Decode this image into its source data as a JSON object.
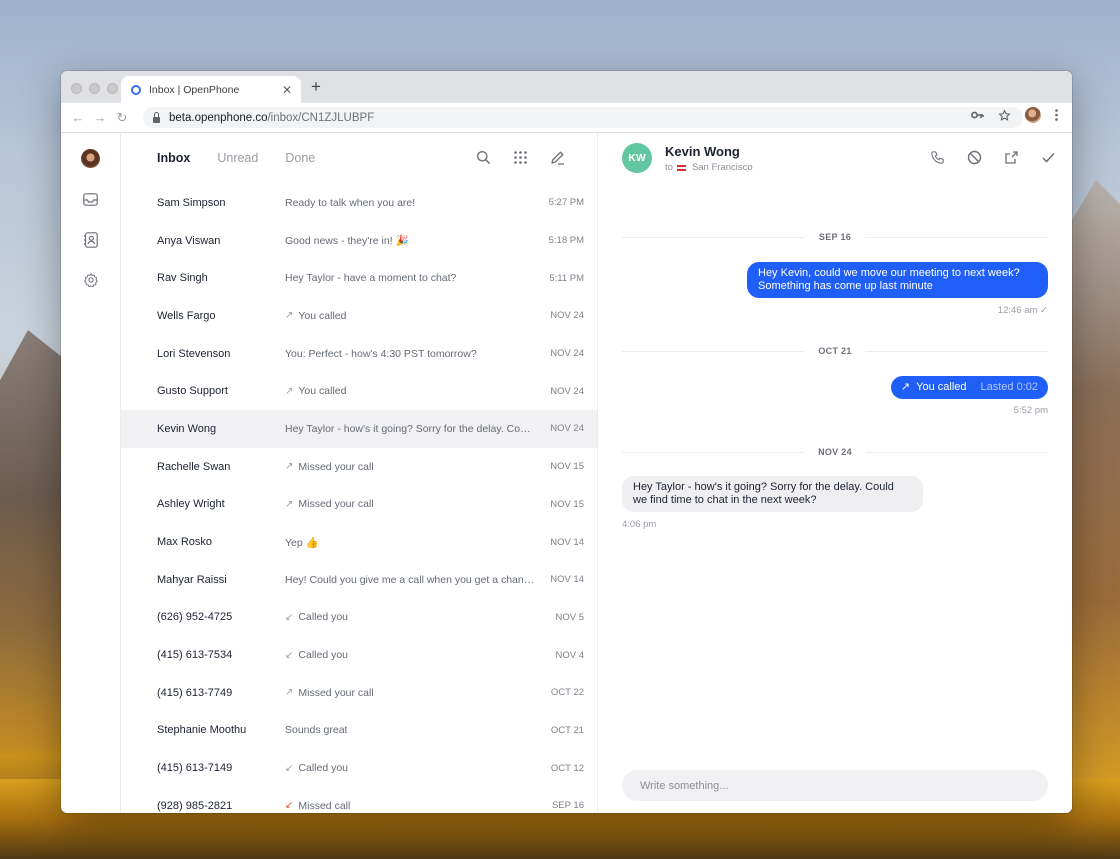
{
  "browser": {
    "tab_title": "Inbox | OpenPhone",
    "tab_close": "✕",
    "new_tab": "+",
    "url_host": "beta.openphone.co",
    "url_path": "/inbox/CN1ZJLUBPF",
    "back": "←",
    "forward": "→",
    "reload": "↻"
  },
  "list": {
    "tabs": [
      "Inbox",
      "Unread",
      "Done"
    ],
    "rows": [
      {
        "name": "Sam Simpson",
        "message": "Ready to talk when you are!",
        "arrow": "",
        "time": "5:27 PM"
      },
      {
        "name": "Anya Viswan",
        "message": "Good news - they're in! 🎉",
        "arrow": "",
        "time": "5:18 PM"
      },
      {
        "name": "Rav Singh",
        "message": "Hey Taylor - have a moment to chat?",
        "arrow": "",
        "time": "5:11 PM"
      },
      {
        "name": "Wells Fargo",
        "message": "You called",
        "arrow": "↗",
        "time": "NOV 24"
      },
      {
        "name": "Lori Stevenson",
        "message": "You: Perfect - how's 4:30 PST tomorrow?",
        "arrow": "",
        "time": "NOV 24"
      },
      {
        "name": "Gusto Support",
        "message": "You called",
        "arrow": "↗",
        "time": "NOV 24"
      },
      {
        "name": "Kevin Wong",
        "message": "Hey Taylor - how's it going? Sorry for the delay. Could we find time to chat",
        "arrow": "",
        "time": "NOV 24",
        "selected": true
      },
      {
        "name": "Rachelle Swan",
        "message": "Missed your call",
        "arrow": "↗",
        "time": "NOV 15"
      },
      {
        "name": "Ashley Wright",
        "message": "Missed your call",
        "arrow": "↗",
        "time": "NOV 15"
      },
      {
        "name": "Max Rosko",
        "message": "Yep 👍",
        "arrow": "",
        "time": "NOV 14"
      },
      {
        "name": "Mahyar Raissi",
        "message": "Hey! Could you give me a call when you get a chance?",
        "arrow": "",
        "time": "NOV 14"
      },
      {
        "name": "(626) 952-4725",
        "message": "Called you",
        "arrow": "↙",
        "time": "NOV 5"
      },
      {
        "name": "(415) 613-7534",
        "message": "Called you",
        "arrow": "↙",
        "time": "NOV 4"
      },
      {
        "name": "(415) 613-7749",
        "message": "Missed your call",
        "arrow": "↗",
        "time": "OCT 22"
      },
      {
        "name": "Stephanie Moothu",
        "message": "Sounds great",
        "arrow": "",
        "time": "OCT 21"
      },
      {
        "name": "(415) 613-7149",
        "message": "Called you",
        "arrow": "↙",
        "time": "OCT 12"
      },
      {
        "name": "(928) 985-2821",
        "message": "Missed call",
        "arrow": "↙",
        "time": "SEP 16",
        "missed": true
      }
    ]
  },
  "conversation": {
    "initials": "KW",
    "avatar_color": "#62c6a2",
    "name": "Kevin Wong",
    "sub_prefix": "to",
    "location": "San Francisco",
    "days": {
      "d1": "SEP 16",
      "d2": "OCT 21",
      "d3": "NOV 24"
    },
    "m1": {
      "line1": "Hey Kevin, could we move our meeting to next week?",
      "line2": "Something has come up last minute",
      "time": "12:46 am ✓"
    },
    "m2": {
      "arrow": "↗",
      "label": "You called",
      "duration": "Lasted 0:02",
      "time": "5:52 pm"
    },
    "m3": {
      "line1": "Hey Taylor - how's it going? Sorry for the delay. Could",
      "line2": "we find time to chat in the next week?",
      "time": "4:06 pm"
    },
    "compose_placeholder": "Write something...",
    "accent": "#1f5ef7"
  }
}
